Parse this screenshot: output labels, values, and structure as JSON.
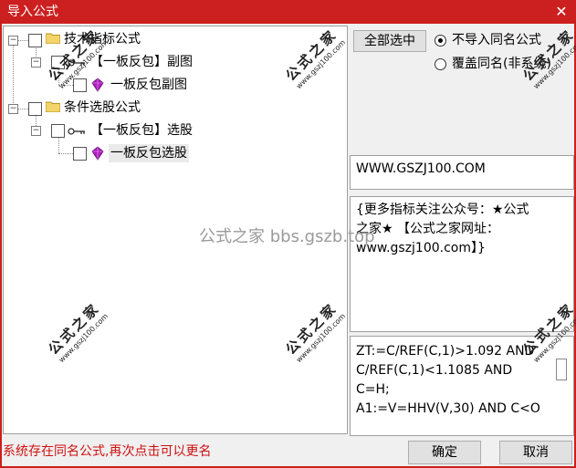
{
  "window": {
    "title": "导入公式",
    "close_glyph": "✕"
  },
  "tree": {
    "nodes": [
      {
        "label": "技术指标公式",
        "type": "folder"
      },
      {
        "label": "【一板反包】副图",
        "type": "key"
      },
      {
        "label": "一板反包副图",
        "type": "gem"
      },
      {
        "label": "条件选股公式",
        "type": "folder"
      },
      {
        "label": "【一板反包】选股",
        "type": "key"
      },
      {
        "label": "一板反包选股",
        "type": "gem"
      }
    ],
    "expander_glyph": "−"
  },
  "right": {
    "select_all_label": "全部选中",
    "radio_options": [
      {
        "label": "不导入同名公式",
        "checked": true
      },
      {
        "label": "覆盖同名(非系统)",
        "checked": false
      }
    ],
    "url_text": "WWW.GSZJ100.COM",
    "info_text": "{更多指标关注公众号：★公式\n之家★ 【公式之家网址：\nwww.gszj100.com】}",
    "code_text": "ZT:=C/REF(C,1)>1.092 AND\nC/REF(C,1)<1.1085 AND\nC=H;\nA1:=V=HHV(V,30) AND C<O"
  },
  "status_text": "系统存在同名公式,再次点击可以更名",
  "buttons": {
    "ok": "确定",
    "cancel": "取消"
  },
  "watermark": {
    "center": "公式之家 bbs.gszb.top",
    "big": "公式之家",
    "small": "www.gszj100.com"
  },
  "colors": {
    "titlebar": "#cc1f1f",
    "status": "#d01010",
    "gem": "#b01ec0"
  }
}
